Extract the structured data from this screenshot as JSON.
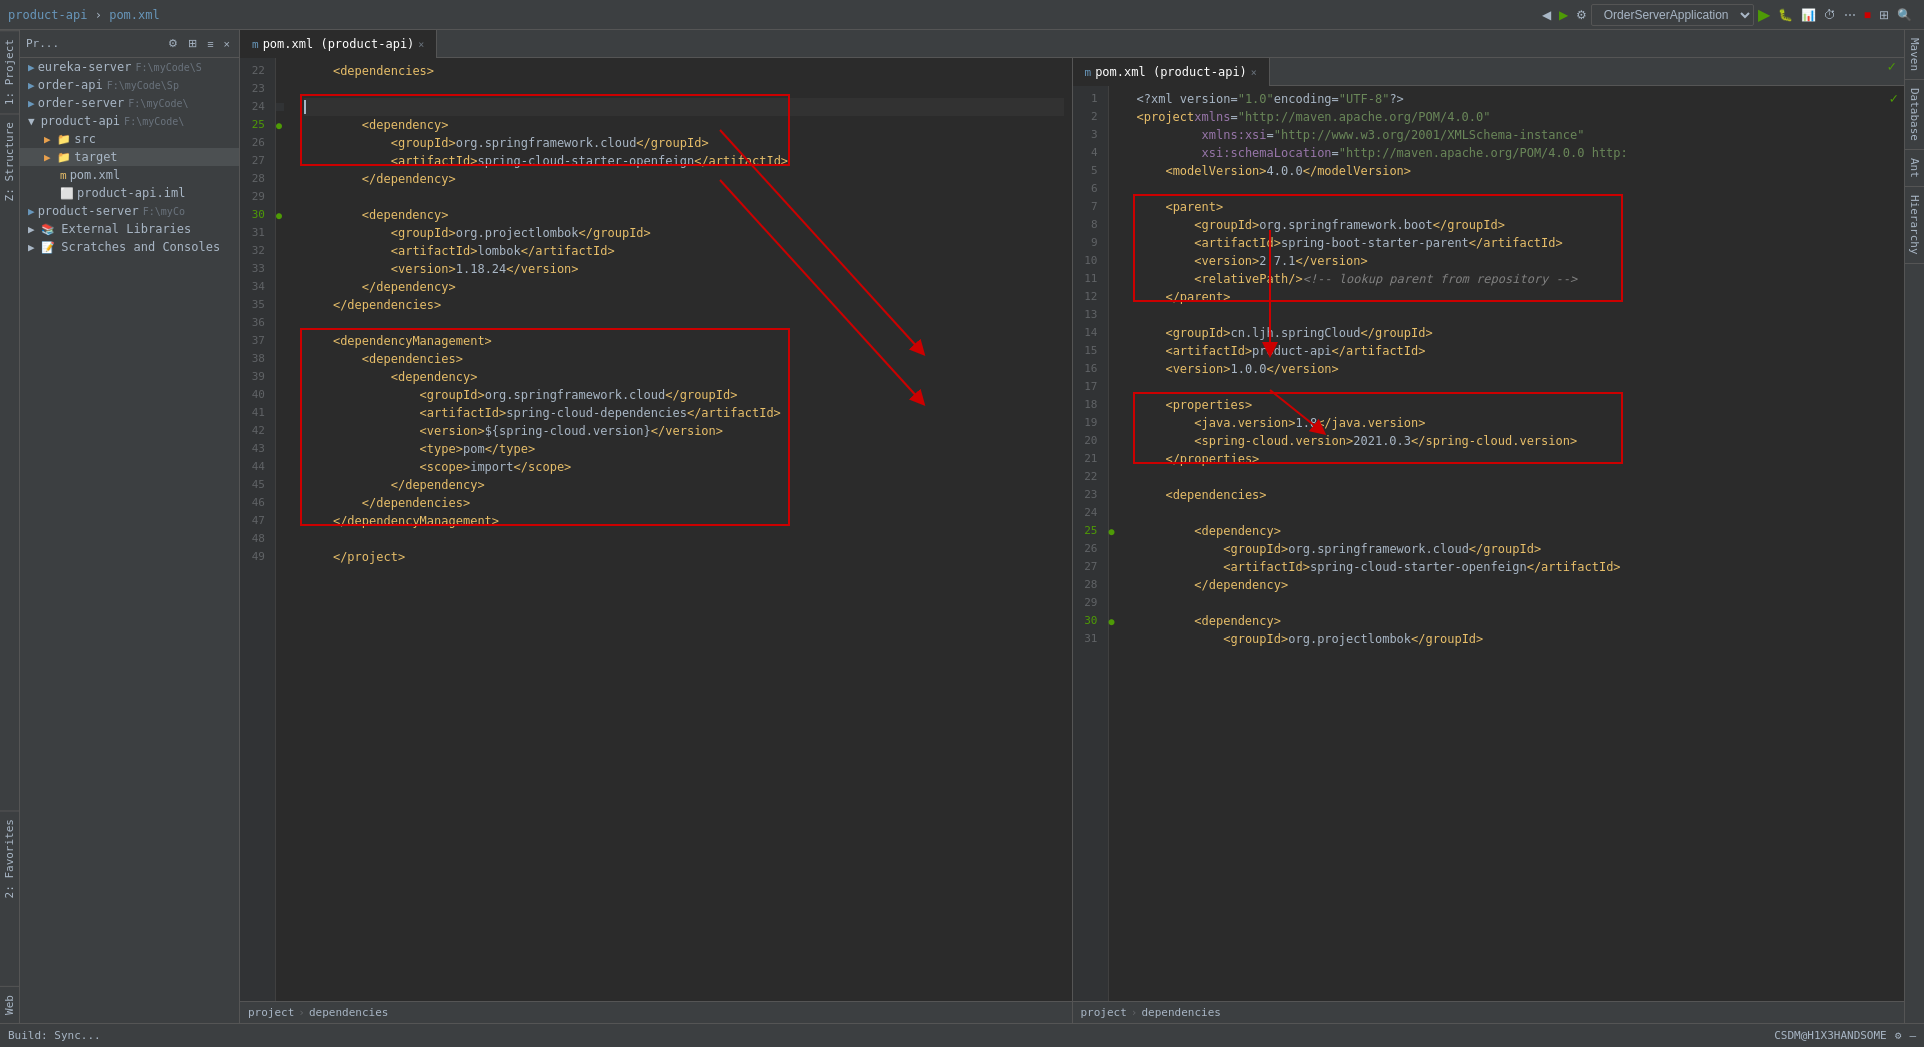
{
  "titlebar": {
    "breadcrumb": "product-api › pom.xml",
    "breadcrumb_parts": [
      "product-api",
      "pom.xml"
    ],
    "run_config": "OrderServerApplication",
    "buttons": [
      "back",
      "forward",
      "settings",
      "minimize"
    ]
  },
  "tabs": {
    "left_tab": "pom.xml (product-api)",
    "right_tab": "pom.xml (product-api)",
    "close": "×"
  },
  "project_panel": {
    "title": "Pr...",
    "items": [
      {
        "label": "eureka-server",
        "path": "F:\\myCode\\S",
        "indent": 1,
        "type": "module"
      },
      {
        "label": "order-api",
        "path": "F:\\myCode\\Sp",
        "indent": 1,
        "type": "module"
      },
      {
        "label": "order-server",
        "path": "F:\\myCode\\",
        "indent": 1,
        "type": "module"
      },
      {
        "label": "product-api",
        "path": "F:\\myCode\\",
        "indent": 1,
        "type": "module",
        "selected": true
      },
      {
        "label": "src",
        "indent": 2,
        "type": "folder"
      },
      {
        "label": "target",
        "indent": 2,
        "type": "folder"
      },
      {
        "label": "pom.xml",
        "indent": 3,
        "type": "file-xml"
      },
      {
        "label": "product-api.iml",
        "indent": 3,
        "type": "file-iml"
      },
      {
        "label": "product-server",
        "path": "F:\\myCo",
        "indent": 1,
        "type": "module"
      },
      {
        "label": "External Libraries",
        "indent": 1,
        "type": "libraries"
      },
      {
        "label": "Scratches and Consoles",
        "indent": 1,
        "type": "scratches"
      }
    ]
  },
  "left_editor": {
    "lines": [
      {
        "num": 22,
        "code": "    <dependencies>"
      },
      {
        "num": 23,
        "code": ""
      },
      {
        "num": 24,
        "code": ""
      },
      {
        "num": 25,
        "code": "        <dependency>",
        "has_gutter": true
      },
      {
        "num": 26,
        "code": "            <groupId>org.springframework.cloud</groupId>"
      },
      {
        "num": 27,
        "code": "            <artifactId>spring-cloud-starter-openfeign</artifactId>"
      },
      {
        "num": 28,
        "code": "        </dependency>"
      },
      {
        "num": 29,
        "code": ""
      },
      {
        "num": 30,
        "code": "        <dependency>",
        "has_gutter": true
      },
      {
        "num": 31,
        "code": "            <groupId>org.projectlombok</groupId>"
      },
      {
        "num": 32,
        "code": "            <artifactId>lombok</artifactId>"
      },
      {
        "num": 33,
        "code": "            <version>1.18.24</version>"
      },
      {
        "num": 34,
        "code": "        </dependency>"
      },
      {
        "num": 35,
        "code": "    </dependencies>"
      },
      {
        "num": 36,
        "code": ""
      },
      {
        "num": 37,
        "code": "    <dependencyManagement>"
      },
      {
        "num": 38,
        "code": "        <dependencies>"
      },
      {
        "num": 39,
        "code": "            <dependency>"
      },
      {
        "num": 40,
        "code": "                <groupId>org.springframework.cloud</groupId>"
      },
      {
        "num": 41,
        "code": "                <artifactId>spring-cloud-dependencies</artifactId>"
      },
      {
        "num": 42,
        "code": "                <version>${spring-cloud.version}</version>"
      },
      {
        "num": 43,
        "code": "                <type>pom</type>"
      },
      {
        "num": 44,
        "code": "                <scope>import</scope>"
      },
      {
        "num": 45,
        "code": "            </dependency>"
      },
      {
        "num": 46,
        "code": "        </dependencies>"
      },
      {
        "num": 47,
        "code": "    </dependencyManagement>"
      },
      {
        "num": 48,
        "code": ""
      },
      {
        "num": 49,
        "code": "    </project>"
      }
    ],
    "status": "project › dependencies"
  },
  "right_editor": {
    "lines": [
      {
        "num": 1,
        "code": "<?xml version=\"1.0\" encoding=\"UTF-8\"?>"
      },
      {
        "num": 2,
        "code": "<project xmlns=\"http://maven.apache.org/POM/4.0.0\""
      },
      {
        "num": 3,
        "code": "         xmlns:xsi=\"http://www.w3.org/2001/XMLSchema-instance\""
      },
      {
        "num": 4,
        "code": "         xsi:schemaLocation=\"http://maven.apache.org/POM/4.0.0 http:"
      },
      {
        "num": 5,
        "code": "    <modelVersion>4.0.0</modelVersion>"
      },
      {
        "num": 6,
        "code": ""
      },
      {
        "num": 7,
        "code": "    <parent>"
      },
      {
        "num": 8,
        "code": "        <groupId>org.springframework.boot</groupId>"
      },
      {
        "num": 9,
        "code": "        <artifactId>spring-boot-starter-parent</artifactId>"
      },
      {
        "num": 10,
        "code": "        <version>2.7.1</version>"
      },
      {
        "num": 11,
        "code": "        <relativePath/> <!-- lookup parent from repository -->"
      },
      {
        "num": 12,
        "code": "    </parent>"
      },
      {
        "num": 13,
        "code": ""
      },
      {
        "num": 14,
        "code": "    <groupId>cn.ljh.springCloud</groupId>"
      },
      {
        "num": 15,
        "code": "    <artifactId>product-api</artifactId>"
      },
      {
        "num": 16,
        "code": "    <version>1.0.0</version>"
      },
      {
        "num": 17,
        "code": ""
      },
      {
        "num": 18,
        "code": "    <properties>"
      },
      {
        "num": 19,
        "code": "        <java.version>1.8</java.version>"
      },
      {
        "num": 20,
        "code": "        <spring-cloud.version>2021.0.3</spring-cloud.version>"
      },
      {
        "num": 21,
        "code": "    </properties>"
      },
      {
        "num": 22,
        "code": ""
      },
      {
        "num": 23,
        "code": "    <dependencies>"
      },
      {
        "num": 24,
        "code": ""
      },
      {
        "num": 25,
        "code": "        <dependency>",
        "has_gutter": true
      },
      {
        "num": 26,
        "code": "            <groupId>org.springframework.cloud</groupId>"
      },
      {
        "num": 27,
        "code": "            <artifactId>spring-cloud-starter-openfeign</artifactId>"
      },
      {
        "num": 28,
        "code": "        </dependency>"
      },
      {
        "num": 29,
        "code": ""
      },
      {
        "num": 30,
        "code": "        <dependency>",
        "has_gutter": true
      },
      {
        "num": 31,
        "code": "            <groupId>org.projectlombok</groupId>"
      }
    ],
    "status": "project › dependencies"
  },
  "sidebar_right_tabs": [
    "Maven",
    "Database",
    "Ant",
    "Hierarchy"
  ],
  "sidebar_left_tabs": [
    "1: Project",
    "2: Structure",
    "2: Favorites"
  ],
  "bottom_bar": {
    "left": "Build: Sync...",
    "right": "CSDM@H1X3HANDSOME"
  }
}
